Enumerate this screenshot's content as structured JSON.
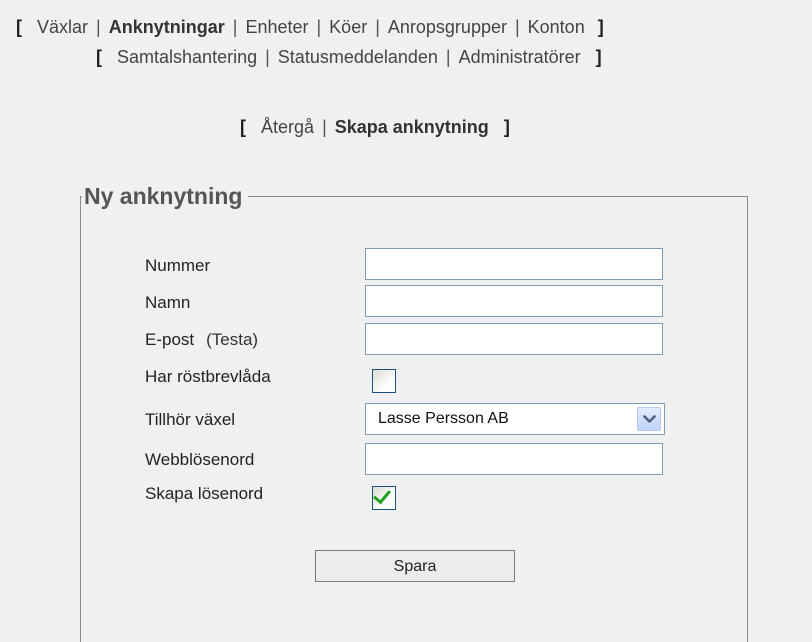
{
  "nav": {
    "main": [
      {
        "label": "Växlar",
        "active": false
      },
      {
        "label": "Anknytningar",
        "active": true
      },
      {
        "label": "Enheter",
        "active": false
      },
      {
        "label": "Köer",
        "active": false
      },
      {
        "label": "Anropsgrupper",
        "active": false
      },
      {
        "label": "Konton",
        "active": false
      }
    ],
    "secondary": [
      {
        "label": "Samtalshantering"
      },
      {
        "label": "Statusmeddelanden"
      },
      {
        "label": "Administratörer"
      }
    ],
    "actions": [
      {
        "label": "Återgå",
        "active": false
      },
      {
        "label": "Skapa anknytning",
        "active": true
      }
    ],
    "bracket_open": "[",
    "bracket_close": "]",
    "separator": "|"
  },
  "form": {
    "legend": "Ny anknytning",
    "fields": {
      "nummer": {
        "label": "Nummer",
        "value": ""
      },
      "namn": {
        "label": "Namn",
        "value": ""
      },
      "epost": {
        "label": "E-post",
        "aside": "(Testa)",
        "value": ""
      },
      "rostbrevlada": {
        "label": "Har röstbrevlåda",
        "checked": false
      },
      "vaxel": {
        "label": "Tillhör växel",
        "selected": "Lasse Persson AB"
      },
      "webblosenord": {
        "label": "Webblösenord",
        "value": ""
      },
      "skapa_losenord": {
        "label": "Skapa lösenord",
        "checked": true
      }
    },
    "submit_label": "Spara"
  },
  "colors": {
    "background": "#f0f0f0",
    "input_border": "#7f9db9",
    "checkmark": "#21a121"
  }
}
